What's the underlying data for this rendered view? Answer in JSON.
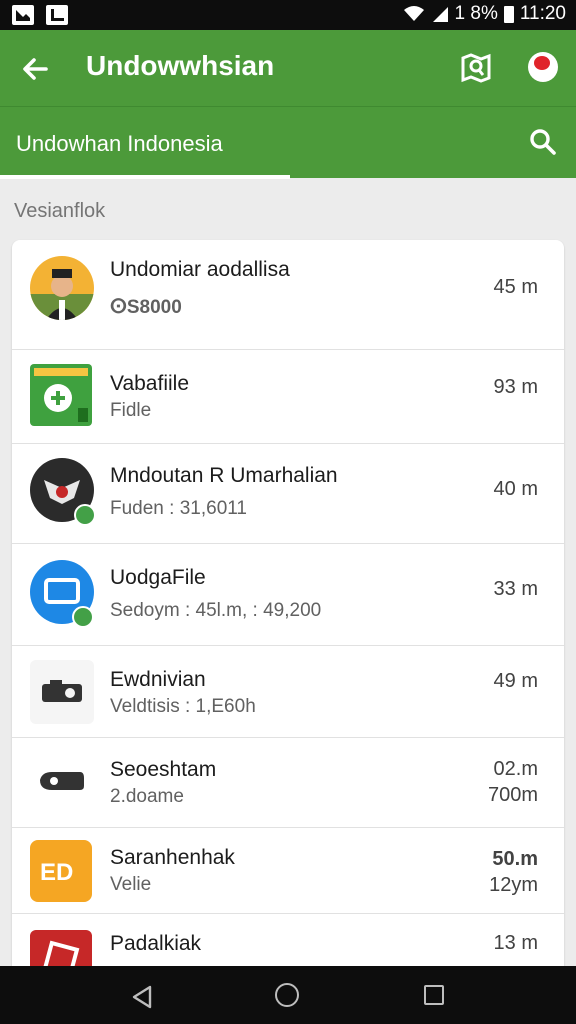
{
  "status_bar": {
    "battery": "1 8%",
    "time": "11:20"
  },
  "app_bar": {
    "title": "Undowwhsian"
  },
  "sub_bar": {
    "title": "Undowhan Indonesia"
  },
  "section": {
    "label": "Vesianflok"
  },
  "items": [
    {
      "title": "Undomiar aodallisa",
      "subtitle": "ⵙS8000",
      "size": "45 m",
      "icon": "person-avatar-icon"
    },
    {
      "title": "Vabafiile",
      "subtitle": "Fidle",
      "size": "93 m",
      "icon": "file-app-icon"
    },
    {
      "title": "Mndoutan R Umarhalian",
      "subtitle": "Fuden : 31,6011",
      "size": "40 m",
      "icon": "garuda-emblem-icon"
    },
    {
      "title": "UodgaFile",
      "subtitle": "Sedoym : 45l.m, : 49,200",
      "size": "33 m",
      "icon": "monitor-app-icon"
    },
    {
      "title": "Ewdnivian",
      "subtitle": "Veldtisis : 1,E60h",
      "size": "49 m",
      "icon": "camera-icon"
    },
    {
      "title": "Seoeshtam",
      "subtitle": "2.doame",
      "size": "02.m",
      "size2": "700m",
      "icon": "projector-icon"
    },
    {
      "title": "Saranhenhak",
      "subtitle": "Velie",
      "size": "50.m",
      "size2": "12ym",
      "icon": "ed-app-icon"
    },
    {
      "title": "Padalkiak",
      "subtitle": "",
      "size": "13 m",
      "icon": "red-app-icon"
    }
  ],
  "colors": {
    "primary": "#4c9a3a",
    "accent_price": "#f0a320",
    "accent_green": "#2e8b2e"
  }
}
